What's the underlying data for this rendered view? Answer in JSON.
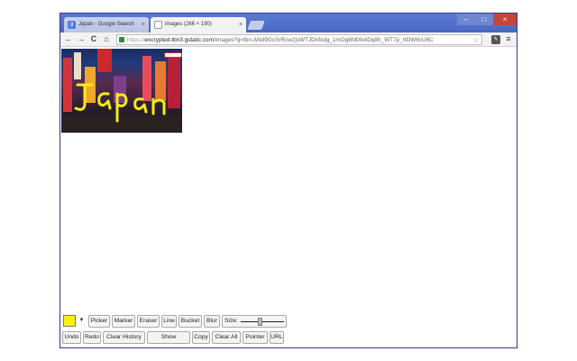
{
  "browser": {
    "tabs": [
      {
        "title": "Japan - Google Search",
        "favicon": "g",
        "close": "×"
      },
      {
        "title": "images (266 × 190)",
        "close": "×"
      }
    ],
    "window_controls": {
      "minimize": "–",
      "maximize": "□",
      "close": "×"
    },
    "nav": {
      "back": "←",
      "forward": "→",
      "reload": "C",
      "home": "⌂"
    },
    "address_bar": {
      "scheme": "https://",
      "host": "encrypted-tbn3.gstatic.com",
      "path": "/images?q=tbn:ANd9GcSrRcw2jsWTJDnfxdg_1mOg8fd0tx4Dq8h_WT7p_rtDW6cU6C"
    }
  },
  "image": {
    "handwriting": "Japan",
    "stroke_color": "#f5ec16"
  },
  "paint_toolbar": {
    "color": "#fff000",
    "color_arrow": "▼",
    "tools_row1": [
      "Picker",
      "Marker",
      "Eraser",
      "Line",
      "Bucket",
      "Blur"
    ],
    "size_label": "Size:",
    "size_level": 0.45,
    "tools_row2": [
      "Undo",
      "Redo",
      "Clear History",
      "Show",
      "Copy",
      "Clear All",
      "Pointer",
      "URL"
    ]
  }
}
